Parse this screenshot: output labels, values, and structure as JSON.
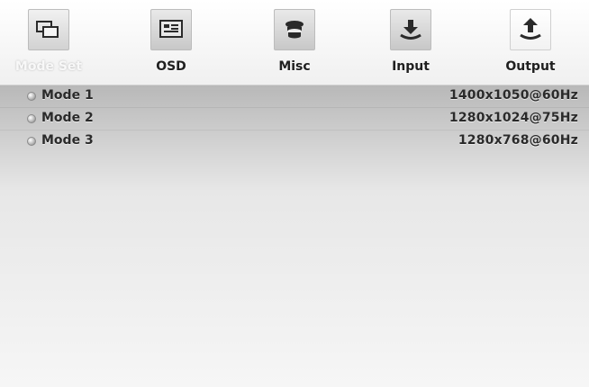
{
  "tabs": [
    {
      "label": "Mode Set",
      "icon": "monitor-windows-icon",
      "active": true
    },
    {
      "label": "OSD",
      "icon": "osd-screen-icon",
      "active": false
    },
    {
      "label": "Misc",
      "icon": "misc-stack-icon",
      "active": false
    },
    {
      "label": "Input",
      "icon": "input-arrow-icon",
      "active": false
    },
    {
      "label": "Output",
      "icon": "output-arrow-icon",
      "active": false
    }
  ],
  "modes": [
    {
      "name": "Mode 1",
      "resolution": "1400x1050@60Hz"
    },
    {
      "name": "Mode 2",
      "resolution": "1280x1024@75Hz"
    },
    {
      "name": "Mode 3",
      "resolution": "1280x768@60Hz"
    }
  ]
}
